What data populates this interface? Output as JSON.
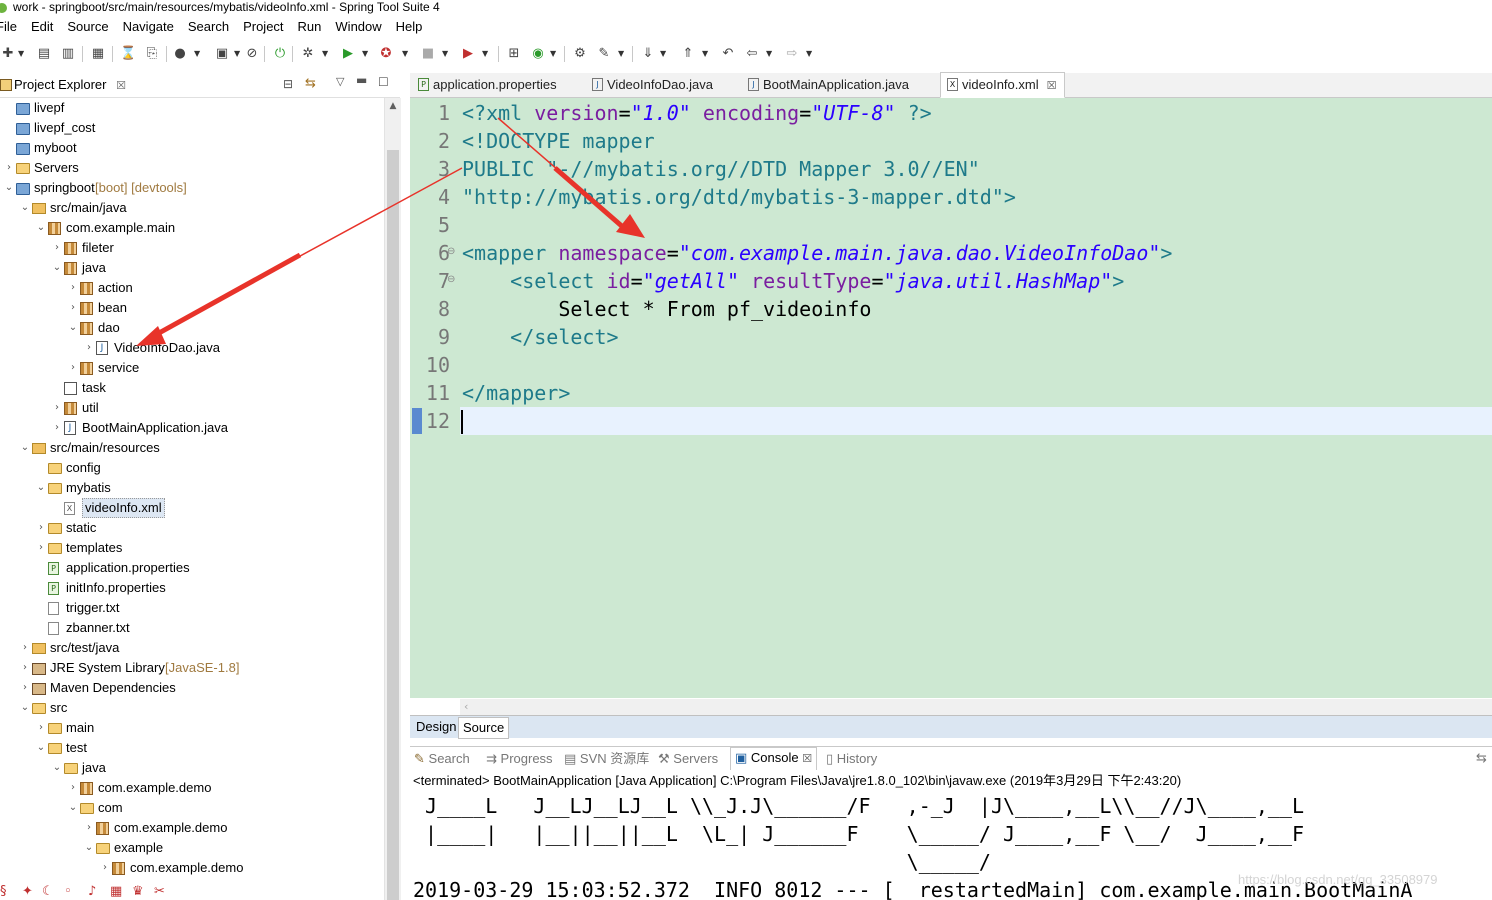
{
  "window": {
    "title": "work - springboot/src/main/resources/mybatis/videoInfo.xml - Spring Tool Suite 4"
  },
  "menu": [
    "File",
    "Edit",
    "Source",
    "Navigate",
    "Search",
    "Project",
    "Run",
    "Window",
    "Help"
  ],
  "project_explorer": {
    "title": "Project Explorer",
    "items": [
      {
        "label": "livepf",
        "icon": "project-icon",
        "tw": "",
        "depth": 0
      },
      {
        "label": "livepf_cost",
        "icon": "project-icon",
        "tw": "",
        "depth": 0
      },
      {
        "label": "myboot",
        "icon": "project-icon",
        "tw": "",
        "depth": 0
      },
      {
        "label": "Servers",
        "icon": "folder-icon",
        "tw": ">",
        "depth": 0
      },
      {
        "label": "springboot",
        "deco": " [boot] [devtools]",
        "icon": "project-icon",
        "tw": "v",
        "depth": 0
      },
      {
        "label": "src/main/java",
        "icon": "source-folder-icon",
        "tw": "v",
        "depth": 1
      },
      {
        "label": "com.example.main",
        "icon": "package-icon",
        "tw": "v",
        "depth": 2
      },
      {
        "label": "fileter",
        "icon": "package-icon",
        "tw": ">",
        "depth": 3
      },
      {
        "label": "java",
        "icon": "package-icon",
        "tw": "v",
        "depth": 3
      },
      {
        "label": "action",
        "icon": "package-icon",
        "tw": ">",
        "depth": 4
      },
      {
        "label": "bean",
        "icon": "package-icon",
        "tw": ">",
        "depth": 4
      },
      {
        "label": "dao",
        "icon": "package-icon",
        "tw": "v",
        "depth": 4
      },
      {
        "label": "VideoInfoDao.java",
        "icon": "java-file-icon",
        "tw": ">",
        "depth": 5
      },
      {
        "label": "service",
        "icon": "package-icon",
        "tw": ">",
        "depth": 4
      },
      {
        "label": "task",
        "icon": "empty-package-icon",
        "tw": "",
        "depth": 3
      },
      {
        "label": "util",
        "icon": "package-icon",
        "tw": ">",
        "depth": 3
      },
      {
        "label": "BootMainApplication.java",
        "icon": "java-file-icon",
        "tw": ">",
        "depth": 3
      },
      {
        "label": "src/main/resources",
        "icon": "source-folder-icon",
        "tw": "v",
        "depth": 1
      },
      {
        "label": "config",
        "icon": "folder-icon",
        "tw": "",
        "depth": 2
      },
      {
        "label": "mybatis",
        "icon": "folder-icon",
        "tw": "v",
        "depth": 2
      },
      {
        "label": "videoInfo.xml",
        "icon": "xml-file-icon",
        "tw": "",
        "depth": 3,
        "selected": true
      },
      {
        "label": "static",
        "icon": "folder-icon",
        "tw": ">",
        "depth": 2
      },
      {
        "label": "templates",
        "icon": "folder-icon",
        "tw": ">",
        "depth": 2
      },
      {
        "label": "application.properties",
        "icon": "properties-file-icon",
        "tw": "",
        "depth": 2
      },
      {
        "label": "initInfo.properties",
        "icon": "properties-file-icon",
        "tw": "",
        "depth": 2
      },
      {
        "label": "trigger.txt",
        "icon": "text-file-icon",
        "tw": "",
        "depth": 2
      },
      {
        "label": "zbanner.txt",
        "icon": "text-file-icon",
        "tw": "",
        "depth": 2
      },
      {
        "label": "src/test/java",
        "icon": "source-folder-icon",
        "tw": ">",
        "depth": 1
      },
      {
        "label": "JRE System Library",
        "deco": " [JavaSE-1.8]",
        "icon": "library-icon",
        "tw": ">",
        "depth": 1
      },
      {
        "label": "Maven Dependencies",
        "icon": "library-icon",
        "tw": ">",
        "depth": 1
      },
      {
        "label": "src",
        "icon": "folder-icon",
        "tw": "v",
        "depth": 1
      },
      {
        "label": "main",
        "icon": "folder-icon",
        "tw": ">",
        "depth": 2
      },
      {
        "label": "test",
        "icon": "folder-icon",
        "tw": "v",
        "depth": 2
      },
      {
        "label": "java",
        "icon": "folder-icon",
        "tw": "v",
        "depth": 3
      },
      {
        "label": "com.example.demo",
        "icon": "package-icon",
        "tw": ">",
        "depth": 4
      },
      {
        "label": "com",
        "icon": "folder-icon",
        "tw": "v",
        "depth": 4
      },
      {
        "label": "com.example.demo",
        "icon": "package-icon",
        "tw": ">",
        "depth": 5
      },
      {
        "label": "example",
        "icon": "folder-icon",
        "tw": "v",
        "depth": 5
      },
      {
        "label": "com.example.demo",
        "icon": "package-icon",
        "tw": ">",
        "depth": 6
      }
    ]
  },
  "editor_tabs": [
    {
      "label": "application.properties",
      "icon": "P",
      "active": false
    },
    {
      "label": "VideoInfoDao.java",
      "icon": "J",
      "active": false
    },
    {
      "label": "BootMainApplication.java",
      "icon": "J",
      "active": false
    },
    {
      "label": "videoInfo.xml",
      "icon": "X",
      "active": true
    }
  ],
  "editor": {
    "line_numbers": [
      "1",
      "2",
      "3",
      "4",
      "5",
      "6",
      "7",
      "8",
      "9",
      "10",
      "11",
      "12"
    ],
    "lines": [
      [
        [
          "br",
          "<?"
        ],
        [
          "tag",
          "xml "
        ],
        [
          "attr",
          "version"
        ],
        [
          "txt",
          "="
        ],
        [
          "val",
          "\"1.0\""
        ],
        [
          "txt",
          " "
        ],
        [
          "attr",
          "encoding"
        ],
        [
          "txt",
          "="
        ],
        [
          "val",
          "\"UTF-8\""
        ],
        [
          "txt",
          " "
        ],
        [
          "br",
          "?>"
        ]
      ],
      [
        [
          "br",
          "<!"
        ],
        [
          "tag",
          "DOCTYPE mapper"
        ]
      ],
      [
        [
          "str",
          "PUBLIC \"-//mybatis.org//DTD Mapper 3.0//EN\""
        ]
      ],
      [
        [
          "str",
          "\"http://mybatis.org/dtd/mybatis-3-mapper.dtd\""
        ],
        [
          "br",
          ">"
        ]
      ],
      [],
      [
        [
          "br",
          "<"
        ],
        [
          "tag",
          "mapper "
        ],
        [
          "attr",
          "namespace"
        ],
        [
          "txt",
          "="
        ],
        [
          "val",
          "\"com.example.main.java.dao.VideoInfoDao\""
        ],
        [
          "br",
          ">"
        ]
      ],
      [
        [
          "txt",
          "    "
        ],
        [
          "br",
          "<"
        ],
        [
          "tag",
          "select "
        ],
        [
          "attr",
          "id"
        ],
        [
          "txt",
          "="
        ],
        [
          "val",
          "\"getAll\""
        ],
        [
          "txt",
          " "
        ],
        [
          "attr",
          "resultType"
        ],
        [
          "txt",
          "="
        ],
        [
          "val",
          "\"java.util.HashMap\""
        ],
        [
          "br",
          ">"
        ]
      ],
      [
        [
          "txt",
          "        Select * From pf_videoinfo"
        ]
      ],
      [
        [
          "txt",
          "    "
        ],
        [
          "br",
          "</"
        ],
        [
          "tag",
          "select"
        ],
        [
          "br",
          ">"
        ]
      ],
      [],
      [
        [
          "br",
          "</"
        ],
        [
          "tag",
          "mapper"
        ],
        [
          "br",
          ">"
        ]
      ],
      []
    ]
  },
  "design_source_tabs": [
    "Design",
    "Source"
  ],
  "console_tabs": [
    "Search",
    "Progress",
    "SVN 资源库",
    "Servers",
    "Console",
    "History"
  ],
  "console": {
    "terminated": "<terminated> BootMainApplication [Java Application] C:\\Program Files\\Java\\jre1.8.0_102\\bin\\javaw.exe (2019年3月29日 下午2:43:20)",
    "lines": [
      " J____L   J__LJ__LJ__L \\\\_J.J\\______/F   ,-_J  |J\\____,__L\\\\__//J\\____,__L",
      " |____|   |__||__||__L  \\L_| J______F    \\_____/ J____,__F \\__/  J____,__F",
      "                                         \\_____/",
      "2019-03-29 15:03:52.372  INFO 8012 --- [  restartedMain] com.example.main.BootMainA"
    ]
  },
  "watermark": "https://blog.csdn.net/qq_33508979"
}
